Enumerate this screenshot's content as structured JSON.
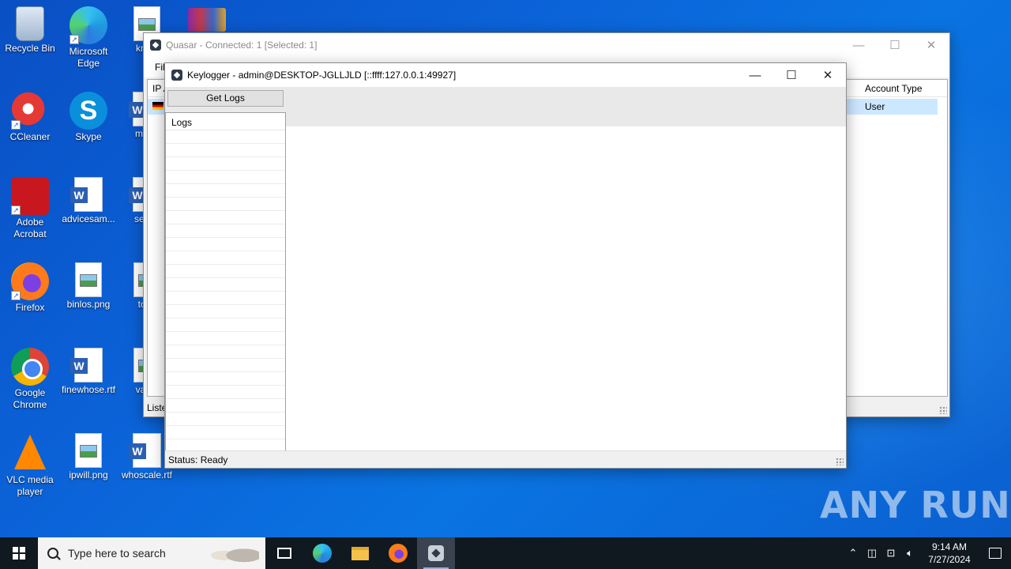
{
  "desktop": {
    "icons": [
      {
        "label": "Recycle Bin"
      },
      {
        "label": "Microsoft Edge"
      },
      {
        "label": "know"
      },
      {
        "label": "CCleaner"
      },
      {
        "label": "Skype"
      },
      {
        "label": "made"
      },
      {
        "label": "Adobe Acrobat"
      },
      {
        "label": "advicesam..."
      },
      {
        "label": "sense"
      },
      {
        "label": "Firefox"
      },
      {
        "label": "binlos.png"
      },
      {
        "label": "took"
      },
      {
        "label": "Google Chrome"
      },
      {
        "label": "finewhose.rtf"
      },
      {
        "label": "value"
      },
      {
        "label": "VLC media player"
      },
      {
        "label": "ipwill.png"
      },
      {
        "label": "whoscale.rtf"
      }
    ]
  },
  "main_window": {
    "title": "Quasar - Connected: 1 [Selected: 1]",
    "menu_partial": "Fil",
    "columns": {
      "ip": "IP A",
      "account_type": "Account Type"
    },
    "selected_row": {
      "account_type": "User"
    },
    "status_partial": "Liste"
  },
  "keylogger_window": {
    "title": "Keylogger - admin@DESKTOP-JGLLJLD [::ffff:127.0.0.1:49927]",
    "get_logs_label": "Get Logs",
    "logs_header": "Logs",
    "status": "Status: Ready"
  },
  "watermark": "ANY RUN",
  "taskbar": {
    "search_placeholder": "Type here to search",
    "time": "9:14 AM",
    "date": "7/27/2024"
  }
}
